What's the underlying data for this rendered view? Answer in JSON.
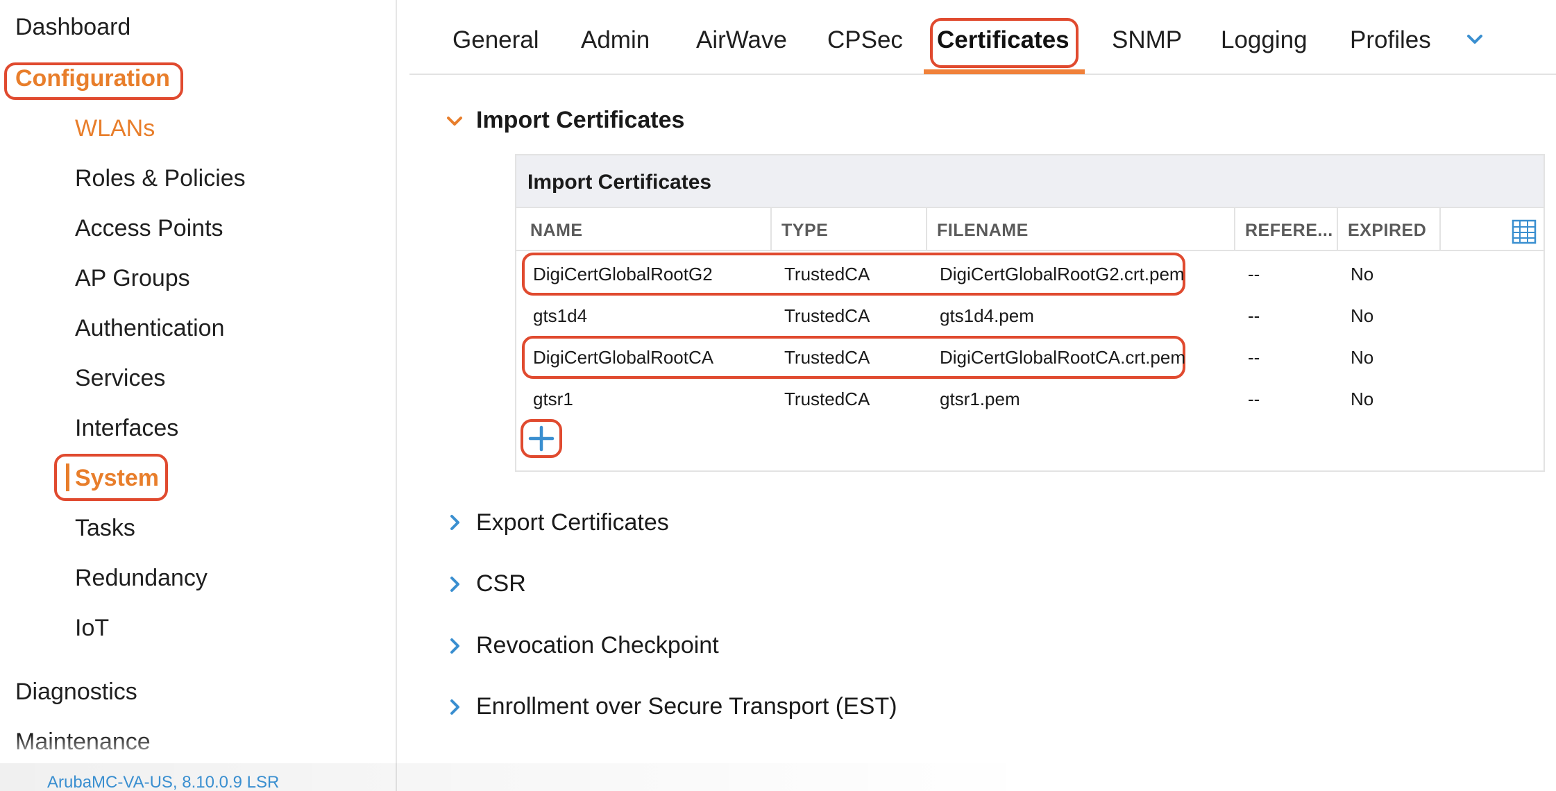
{
  "sidebar": {
    "dashboard": "Dashboard",
    "configuration": "Configuration",
    "items": [
      "WLANs",
      "Roles & Policies",
      "Access Points",
      "AP Groups",
      "Authentication",
      "Services",
      "Interfaces",
      "System",
      "Tasks",
      "Redundancy",
      "IoT"
    ],
    "diagnostics": "Diagnostics",
    "maintenance": "Maintenance",
    "footer_version": "ArubaMC-VA-US, 8.10.0.9 LSR"
  },
  "tabs": [
    "General",
    "Admin",
    "AirWave",
    "CPSec",
    "Certificates",
    "SNMP",
    "Logging",
    "Profiles"
  ],
  "active_tab": "Certificates",
  "sections": {
    "import_title": "Import Certificates",
    "export_title": "Export Certificates",
    "csr_title": "CSR",
    "revocation_title": "Revocation Checkpoint",
    "est_title": "Enrollment over Secure Transport (EST)"
  },
  "panel": {
    "title": "Import Certificates",
    "columns": [
      "NAME",
      "TYPE",
      "FILENAME",
      "REFERE...",
      "EXPIRED"
    ],
    "rows": [
      [
        "DigiCertGlobalRootG2",
        "TrustedCA",
        "DigiCertGlobalRootG2.crt.pem",
        "--",
        "No"
      ],
      [
        "gts1d4",
        "TrustedCA",
        "gts1d4.pem",
        "--",
        "No"
      ],
      [
        "DigiCertGlobalRootCA",
        "TrustedCA",
        "DigiCertGlobalRootCA.crt.pem",
        "--",
        "No"
      ],
      [
        "gtsr1",
        "TrustedCA",
        "gtsr1.pem",
        "--",
        "No"
      ]
    ]
  },
  "colors": {
    "accent_orange": "#e87e2b",
    "highlight_red": "#e04a2f",
    "link_blue": "#3a8fd0",
    "tab_underline": "#f0813a"
  },
  "icons": {
    "tabs_more": "chevron-down-icon",
    "section_expanded": "chevron-down-icon",
    "section_collapsed": "chevron-right-icon",
    "table_columns": "grid-icon",
    "add": "plus-icon"
  }
}
